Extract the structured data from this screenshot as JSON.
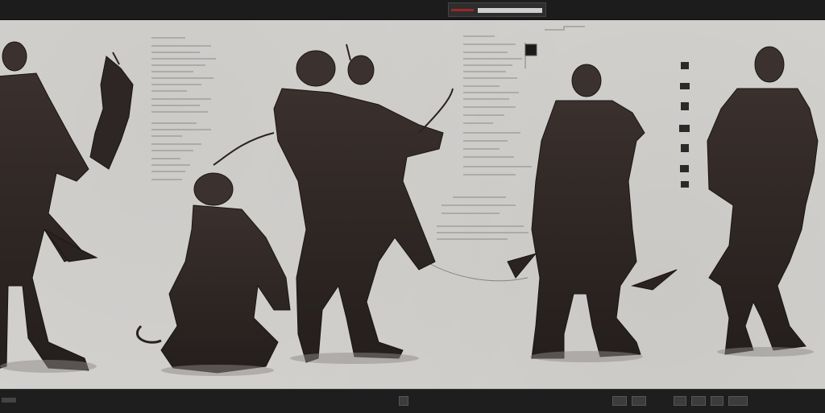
{
  "window": {
    "accent_color": "#9e2525",
    "tab_field_value": ""
  },
  "canvas": {
    "background": "#d5d3d0",
    "ink_color": "#2d2826",
    "figures": [
      {
        "name": "figure-standing-left"
      },
      {
        "name": "figure-cloak-fragment"
      },
      {
        "name": "figure-crouching"
      },
      {
        "name": "figure-leaping"
      },
      {
        "name": "figure-standing-center-right"
      },
      {
        "name": "figure-standing-right"
      }
    ]
  },
  "statusbar": {
    "buttons": [
      {
        "name": "status-button-1"
      },
      {
        "name": "status-button-2"
      },
      {
        "name": "status-button-3"
      },
      {
        "name": "status-button-4"
      },
      {
        "name": "status-button-5"
      },
      {
        "name": "status-button-6"
      },
      {
        "name": "status-button-7"
      }
    ]
  }
}
